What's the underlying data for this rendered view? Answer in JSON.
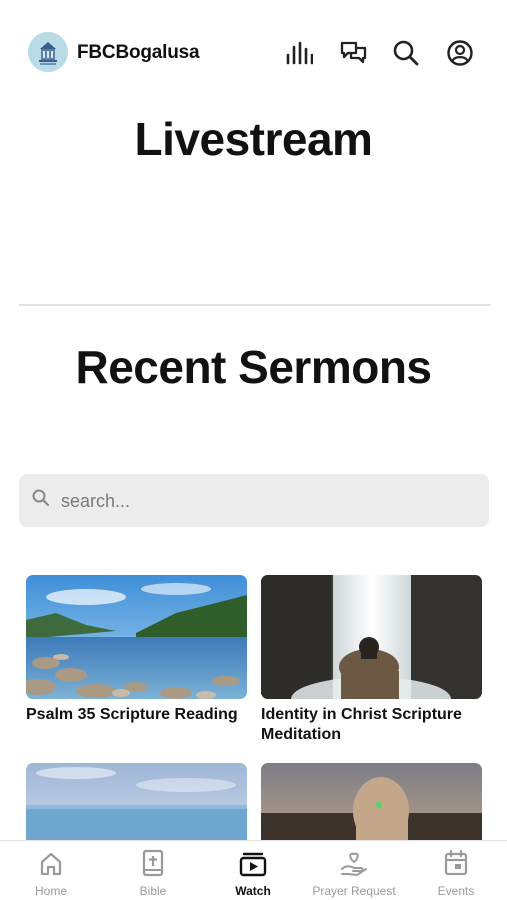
{
  "header": {
    "app_name": "FBCBogalusa",
    "logo_icon": "church-building-icon",
    "icons": [
      "audio-bars-icon",
      "chat-bubbles-icon",
      "search-icon",
      "account-icon"
    ]
  },
  "sections": {
    "livestream_title": "Livestream",
    "sermons_title": "Recent Sermons"
  },
  "search": {
    "placeholder": "search...",
    "value": ""
  },
  "sermons": [
    {
      "title": "Psalm 35 Scripture Reading",
      "image": "lake-forest-landscape"
    },
    {
      "title": "Identity in Christ Scripture Meditation",
      "image": "waterfall-person"
    },
    {
      "title": "",
      "image": "ocean-sky"
    },
    {
      "title": "",
      "image": "person-sunset"
    }
  ],
  "tabbar": {
    "items": [
      {
        "label": "Home",
        "icon": "home-icon",
        "active": false
      },
      {
        "label": "Bible",
        "icon": "bible-icon",
        "active": false
      },
      {
        "label": "Watch",
        "icon": "play-video-icon",
        "active": true
      },
      {
        "label": "Prayer Request",
        "icon": "praying-hands-heart-icon",
        "active": false
      },
      {
        "label": "Events",
        "icon": "calendar-icon",
        "active": false
      }
    ]
  },
  "colors": {
    "accent": "#111111",
    "inactive": "#9a9a9a",
    "search_bg": "#ececec",
    "logo_bg": "#b9dbe8"
  }
}
